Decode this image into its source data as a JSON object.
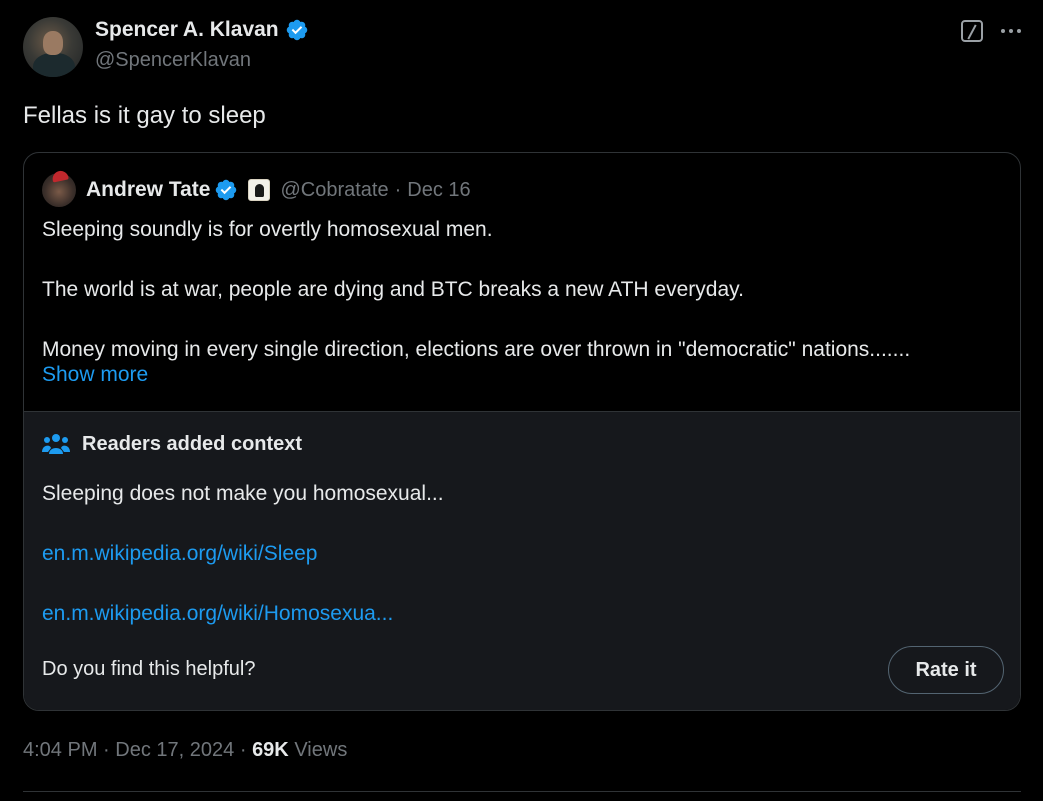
{
  "author": {
    "name": "Spencer A. Klavan",
    "handle": "@SpencerKlavan"
  },
  "tweet": {
    "text": "Fellas is it gay to sleep"
  },
  "quote": {
    "name": "Andrew Tate",
    "handle": "@Cobratate",
    "separator": "·",
    "date": "Dec 16",
    "paragraphs": [
      "Sleeping soundly is for overtly homosexual men.",
      "The world is at war, people are dying and BTC breaks a new ATH everyday.",
      "Money moving in every single direction, elections are over thrown in \"democratic\" nations......."
    ],
    "show_more": "Show more"
  },
  "context": {
    "title": "Readers added context",
    "text": "Sleeping does not make you homosexual...",
    "links": [
      "en.m.wikipedia.org/wiki/Sleep",
      "en.m.wikipedia.org/wiki/Homosexua..."
    ],
    "helpful_prompt": "Do you find this helpful?",
    "rate_label": "Rate it"
  },
  "footer": {
    "time": "4:04 PM",
    "date": "Dec 17, 2024",
    "sep1": "·",
    "sep2": "·",
    "views_count": "69K",
    "views_label": "Views"
  },
  "icons": {
    "verified": "verified-badge-icon",
    "grok": "grok-icon",
    "more": "more-icon",
    "context": "people-group-icon"
  },
  "colors": {
    "background": "#000000",
    "accent": "#1d9bf0",
    "muted": "#71767b",
    "text": "#e7e9ea",
    "card_border": "#2f3336",
    "context_bg": "#16181c"
  }
}
